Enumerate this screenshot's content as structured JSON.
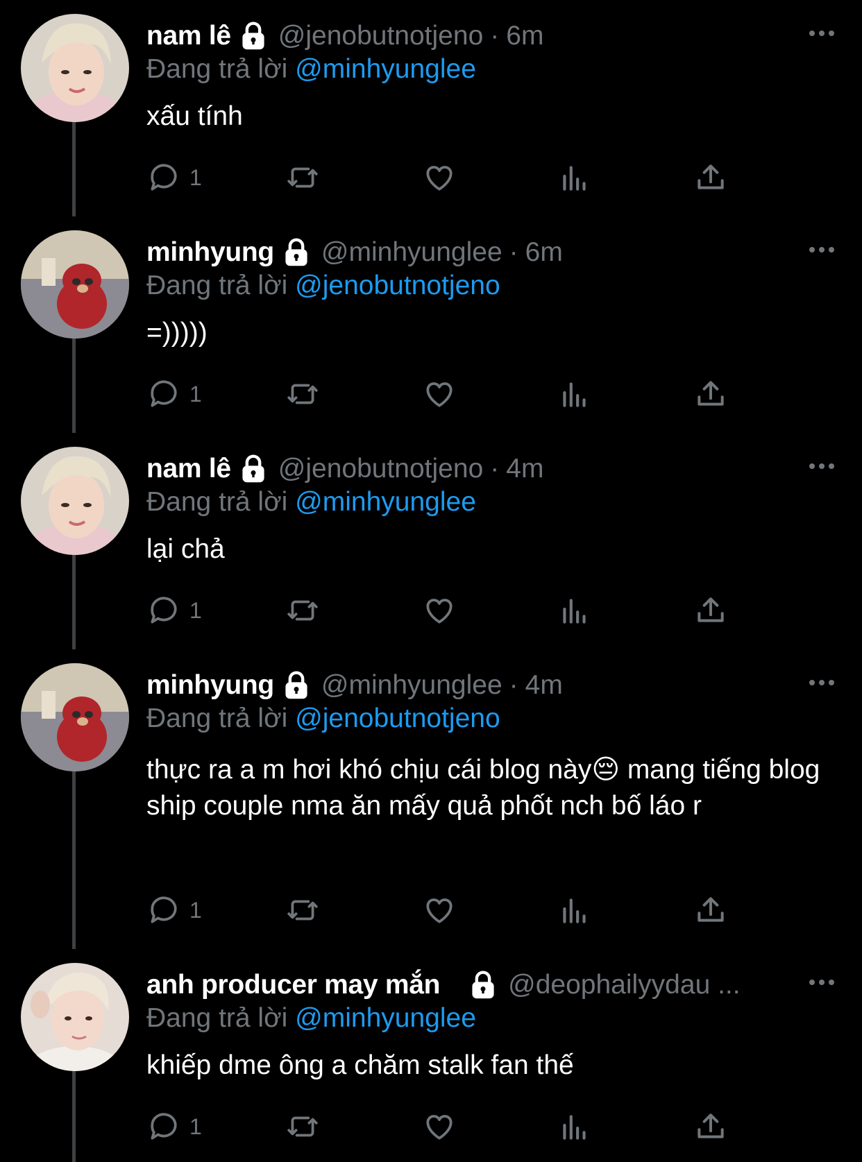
{
  "tweets": [
    {
      "name": "nam lê",
      "handle": "@jenobutnotjeno",
      "time": "6m",
      "reply_prefix": "Đang trả lời",
      "reply_to": "@minhyunglee",
      "text": "xấu tính",
      "reply_count": "1",
      "avatar": "blonde-person"
    },
    {
      "name": "minhyung",
      "handle": "@minhyunglee",
      "time": "6m",
      "reply_prefix": "Đang trả lời",
      "reply_to": "@jenobutnotjeno",
      "text": "=)))))",
      "reply_count": "1",
      "avatar": "teddy-bear"
    },
    {
      "name": "nam lê",
      "handle": "@jenobutnotjeno",
      "time": "4m",
      "reply_prefix": "Đang trả lời",
      "reply_to": "@minhyunglee",
      "text": "lại chả",
      "reply_count": "1",
      "avatar": "blonde-person"
    },
    {
      "name": "minhyung",
      "handle": "@minhyunglee",
      "time": "4m",
      "reply_prefix": "Đang trả lời",
      "reply_to": "@jenobutnotjeno",
      "text": "thực ra a m hơi khó chịu cái blog này😔 mang tiếng blog ship couple nma ăn mấy quả phốt nch bố láo r",
      "reply_count": "1",
      "avatar": "teddy-bear"
    },
    {
      "name": "anh producer may mắn",
      "handle": "@deophailyydau ...",
      "time": "",
      "reply_prefix": "Đang trả lời",
      "reply_to": "@minhyunglee",
      "text": "khiếp dme ông a chăm stalk fan thế",
      "reply_count": "1",
      "avatar": "light-hair-person"
    }
  ],
  "separator": "·",
  "icons": {
    "lock": "lock-icon",
    "more": "more-options-icon",
    "reply": "reply-icon",
    "retweet": "retweet-icon",
    "like": "like-icon",
    "views": "views-icon",
    "share": "share-icon"
  },
  "colors": {
    "background": "#000000",
    "text": "#ffffff",
    "secondary": "#71767b",
    "link": "#1d9bf0",
    "thread_line": "#3e4144"
  }
}
